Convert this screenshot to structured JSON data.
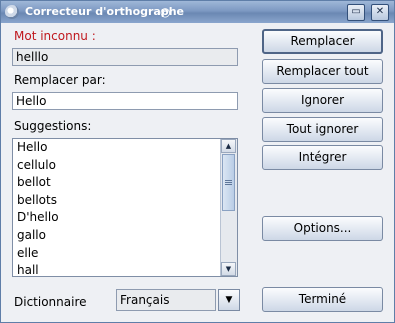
{
  "window": {
    "title": "Correcteur d'orthographe",
    "title_deco": "◎",
    "controls": {
      "minimize": "▭",
      "close": "✕"
    }
  },
  "unknown_word": {
    "label": "Mot inconnu :",
    "value": "helllo"
  },
  "replace_with": {
    "label": "Remplacer par:",
    "value": "Hello"
  },
  "suggestions": {
    "label": "Suggestions:",
    "items": [
      "Hello",
      "cellulo",
      "bellot",
      "bellots",
      "D'hello",
      "gallo",
      "elle",
      "hall"
    ]
  },
  "dictionary": {
    "label": "Dictionnaire",
    "selected": "Français"
  },
  "buttons": {
    "replace": "Remplacer",
    "replace_all": "Remplacer tout",
    "ignore": "Ignorer",
    "ignore_all": "Tout ignorer",
    "add": "Intégrer",
    "options": "Options...",
    "done": "Terminé"
  },
  "icons": {
    "scroll_up": "▲",
    "scroll_down": "▼",
    "dropdown": "▼"
  }
}
